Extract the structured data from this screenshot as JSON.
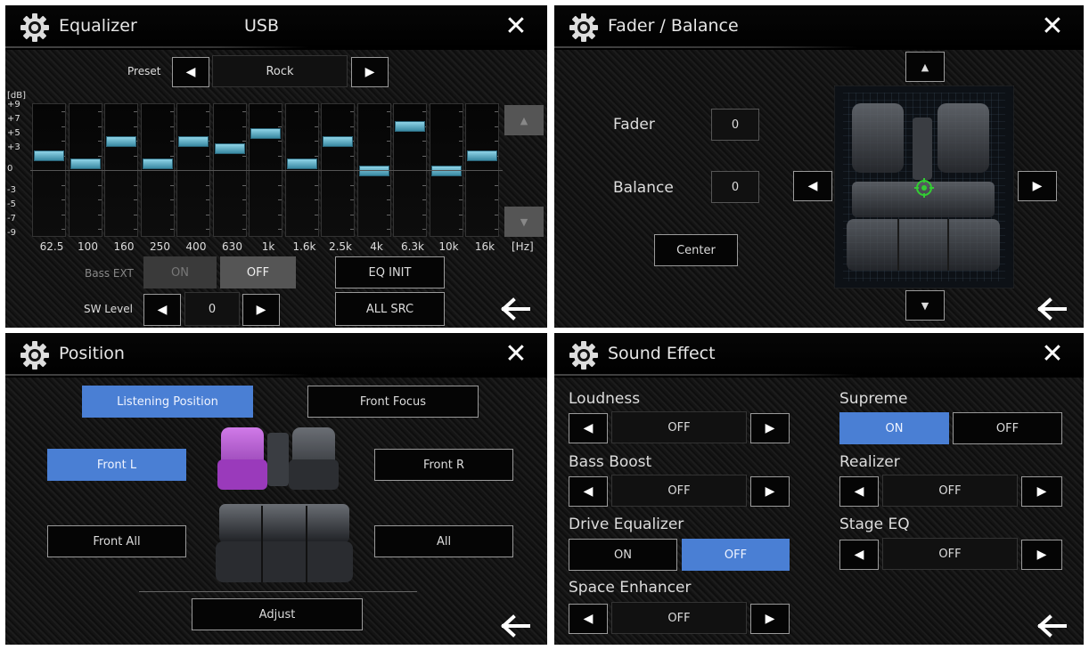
{
  "equalizer": {
    "title": "Equalizer",
    "source": "USB",
    "preset_label": "Preset",
    "preset_value": "Rock",
    "db_label": "[dB]",
    "db_ticks": [
      "+9",
      "+7",
      "+5",
      "+3",
      "0",
      "-3",
      "-5",
      "-7",
      "-9"
    ],
    "bands": [
      {
        "freq": "62.5",
        "level": 2
      },
      {
        "freq": "100",
        "level": 1
      },
      {
        "freq": "160",
        "level": 4
      },
      {
        "freq": "250",
        "level": 1
      },
      {
        "freq": "400",
        "level": 4
      },
      {
        "freq": "630",
        "level": 3
      },
      {
        "freq": "1k",
        "level": 5
      },
      {
        "freq": "1.6k",
        "level": 1
      },
      {
        "freq": "2.5k",
        "level": 4
      },
      {
        "freq": "4k",
        "level": 0
      },
      {
        "freq": "6.3k",
        "level": 6
      },
      {
        "freq": "10k",
        "level": 0
      },
      {
        "freq": "16k",
        "level": 2
      }
    ],
    "hz_label": "[Hz]",
    "bass_ext_label": "Bass EXT",
    "bass_on": "ON",
    "bass_off": "OFF",
    "eq_init": "EQ INIT",
    "sw_level_label": "SW Level",
    "sw_level_value": "0",
    "all_src": "ALL SRC"
  },
  "fader_balance": {
    "title": "Fader / Balance",
    "fader_label": "Fader",
    "fader_value": "0",
    "balance_label": "Balance",
    "balance_value": "0",
    "center_label": "Center"
  },
  "position": {
    "title": "Position",
    "listening_position": "Listening Position",
    "front_focus": "Front Focus",
    "front_l": "Front L",
    "front_r": "Front R",
    "front_all": "Front All",
    "all": "All",
    "adjust": "Adjust"
  },
  "sound_effect": {
    "title": "Sound Effect",
    "loudness_label": "Loudness",
    "loudness_value": "OFF",
    "bass_boost_label": "Bass Boost",
    "bass_boost_value": "OFF",
    "drive_eq_label": "Drive Equalizer",
    "drive_eq_on": "ON",
    "drive_eq_off": "OFF",
    "space_enh_label": "Space Enhancer",
    "space_enh_value": "OFF",
    "supreme_label": "Supreme",
    "supreme_on": "ON",
    "supreme_off": "OFF",
    "realizer_label": "Realizer",
    "realizer_value": "OFF",
    "stage_eq_label": "Stage EQ",
    "stage_eq_value": "OFF"
  },
  "icons": {
    "gear": "gear-icon",
    "close": "close-icon",
    "back": "back-arrow-icon"
  },
  "colors": {
    "accent": "#4a7fd4",
    "eq_knob": "#5bb0c8",
    "seat_highlight": "#a040c8",
    "speaker_marker": "#33cc33"
  }
}
